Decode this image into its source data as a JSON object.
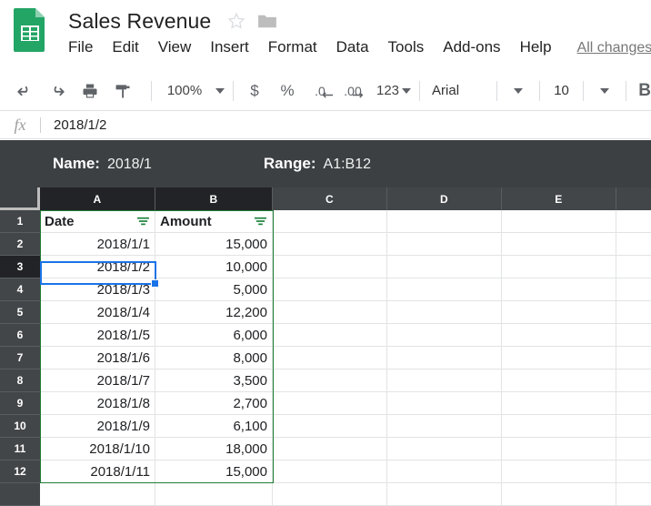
{
  "header": {
    "logo_icon": "sheets-doc-icon",
    "doc_title": "Sales Revenue",
    "star_icon": "star-outline-icon",
    "folder_icon": "folder-icon",
    "menus": [
      "File",
      "Edit",
      "View",
      "Insert",
      "Format",
      "Data",
      "Tools",
      "Add-ons",
      "Help"
    ],
    "save_status": "All changes"
  },
  "toolbar": {
    "undo_icon": "undo-icon",
    "redo_icon": "redo-icon",
    "print_icon": "print-icon",
    "paint_format_icon": "paint-format-icon",
    "zoom_value": "100%",
    "currency_label": "$",
    "percent_label": "%",
    "decrease_decimal_label": ".0",
    "increase_decimal_label": ".00",
    "number_format_label": "123",
    "font_family_value": "Arial",
    "font_size_value": "10",
    "bold_label": "B"
  },
  "formula_bar": {
    "fx_label": "fx",
    "value": "2018/1/2"
  },
  "info_bar": {
    "name_label": "Name:",
    "name_value": "2018/1",
    "range_label": "Range:",
    "range_value": "A1:B12",
    "background_color": "#3c4043"
  },
  "grid": {
    "column_headers": [
      "A",
      "B",
      "C",
      "D",
      "E"
    ],
    "selected_columns": [
      "A",
      "B"
    ],
    "row_numbers": [
      "1",
      "2",
      "3",
      "4",
      "5",
      "6",
      "7",
      "8",
      "9",
      "10",
      "11",
      "12"
    ],
    "selected_row": "3",
    "active_cell": "A3",
    "filter_icon": "filter-icon",
    "filter_icon_color": "#188038",
    "selection_color": "#1a73e8",
    "filter_range_border_color": "#1e7e34",
    "header_row": {
      "a": "Date",
      "b": "Amount"
    },
    "rows": [
      {
        "date": "2018/1/1",
        "amount": "15,000"
      },
      {
        "date": "2018/1/2",
        "amount": "10,000"
      },
      {
        "date": "2018/1/3",
        "amount": "5,000"
      },
      {
        "date": "2018/1/4",
        "amount": "12,200"
      },
      {
        "date": "2018/1/5",
        "amount": "6,000"
      },
      {
        "date": "2018/1/6",
        "amount": "8,000"
      },
      {
        "date": "2018/1/7",
        "amount": "3,500"
      },
      {
        "date": "2018/1/8",
        "amount": "2,700"
      },
      {
        "date": "2018/1/9",
        "amount": "6,100"
      },
      {
        "date": "2018/1/10",
        "amount": "18,000"
      },
      {
        "date": "2018/1/11",
        "amount": "15,000"
      }
    ]
  }
}
